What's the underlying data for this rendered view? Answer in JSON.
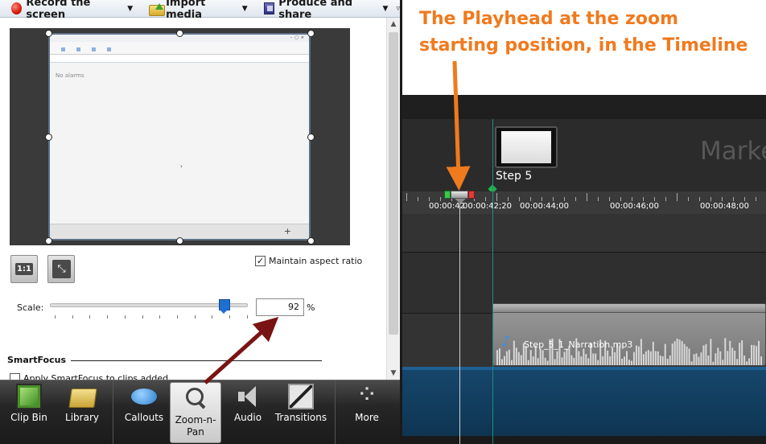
{
  "toolbar": {
    "record_label": "Record the screen",
    "import_label": "Import media",
    "produce_label": "Produce and share"
  },
  "preview": {
    "no_alarms_text": "No alarms"
  },
  "zoom_panel": {
    "btn_one_to_one": "1:1",
    "maintain_aspect_label": "Maintain aspect ratio",
    "maintain_aspect_checked": true,
    "scale_label": "Scale:",
    "scale_value": "92",
    "scale_unit": "%",
    "slider_fraction": 0.88,
    "smartfocus_heading": "SmartFocus",
    "smartfocus_apply_label": "Apply SmartFocus to clips added"
  },
  "tabs": [
    {
      "label": "Clip Bin",
      "icon": "film-icon"
    },
    {
      "label": "Library",
      "icon": "folder-icon"
    },
    {
      "label": "Callouts",
      "icon": "speech-bubble-icon"
    },
    {
      "label": "Zoom-n-\nPan",
      "icon": "magnifier-icon",
      "active": true
    },
    {
      "label": "Audio",
      "icon": "speaker-icon"
    },
    {
      "label": "Transitions",
      "icon": "transition-icon"
    },
    {
      "label": "More",
      "icon": "dots-icon"
    }
  ],
  "annotation": {
    "caption": "The Playhead at the zoom starting position, in the Timeline",
    "color": "#f07a1e",
    "arrow_color": "#7a1414"
  },
  "timeline": {
    "marker_text": "Marke",
    "step_label": "Step 5",
    "time_labels": [
      "00:00:42",
      "00:00:42;20",
      "00:00:44;00",
      "00:00:46;00",
      "00:00:48;00"
    ],
    "clip_name": "Step_5_1_Narration.mp3"
  }
}
